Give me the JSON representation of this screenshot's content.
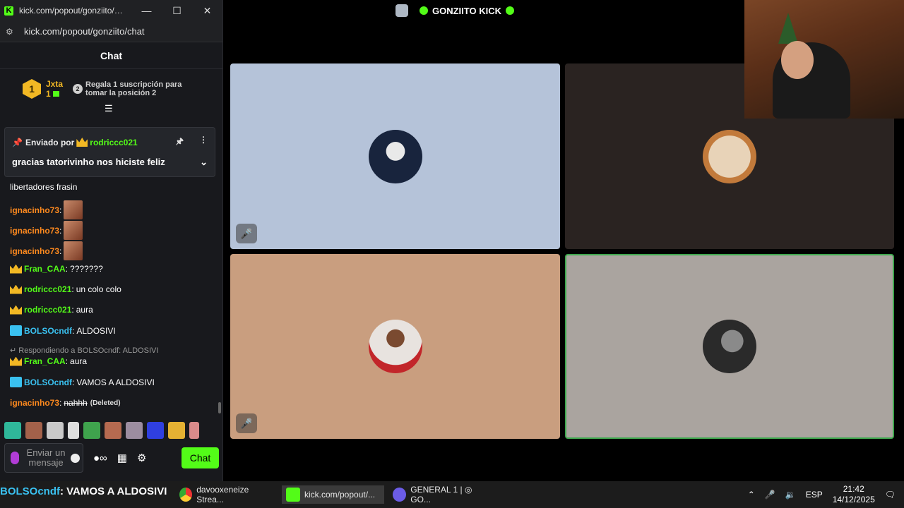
{
  "chat_window": {
    "title": "kick.com/popout/gonziito/chat",
    "url": "kick.com/popout/gonziito/chat",
    "minimize_icon": "minimize-icon",
    "maximize_icon": "maximize-icon",
    "close_icon": "close-icon",
    "header": "Chat"
  },
  "leaderboard": {
    "rank": "1",
    "name": "Jxta",
    "count": "1",
    "rank2": "2",
    "gift_text": "Regala 1 suscripción para tomar la posición 2"
  },
  "pinned": {
    "sent_by": "Enviado por",
    "user": "rodriccc021",
    "message": "gracias tatorivinho nos hiciste feliz"
  },
  "messages": [
    {
      "user": "",
      "text": "libertadores frasin",
      "color": "#ffffff"
    },
    {
      "user": "ignacinho73",
      "text": "",
      "color": "#ff8a1e",
      "emote": true
    },
    {
      "user": "ignacinho73",
      "text": "",
      "color": "#ff8a1e",
      "emote": true
    },
    {
      "user": "ignacinho73",
      "text": "",
      "color": "#ff8a1e",
      "emote": true
    },
    {
      "user": "Fran_CAA",
      "text": "???????",
      "color": "#53fc18",
      "badge": "crown"
    },
    {
      "user": "rodriccc021",
      "text": "un colo colo",
      "color": "#53fc18",
      "badge": "crown"
    },
    {
      "user": "rodriccc021",
      "text": "aura",
      "color": "#53fc18",
      "badge": "crown"
    },
    {
      "user": "BOLSOcndf",
      "text": "ALDOSIVI",
      "color": "#3ac1f0",
      "badge": "sub"
    },
    {
      "user": "Fran_CAA",
      "text": "aura",
      "color": "#53fc18",
      "badge": "crown"
    },
    {
      "user": "BOLSOcndf",
      "text": "VAMOS A ALDOSIVI",
      "color": "#3ac1f0",
      "badge": "sub"
    },
    {
      "user": "ignacinho73",
      "text": "nahhh",
      "color": "#ff8a1e",
      "deleted": "(Deleted)"
    }
  ],
  "reply": "Respondiendo a BOLSOcndf: ALDOSIVI",
  "input": {
    "placeholder": "Enviar un mensaje",
    "send_label": "Chat"
  },
  "stage": {
    "title": "GONZIITO KICK"
  },
  "tiles_colors": [
    "#b5c3d9",
    "#2a2321",
    "#c99e7f",
    "#aaa49f"
  ],
  "taskbar": {
    "overlay_user": "BOLSOcndf",
    "overlay_text": ": VAMOS A ALDOSIVI",
    "item1": "davooxeneize Strea...",
    "item2": "kick.com/popout/...",
    "item3": "GENERAL 1 | ◎ GO...",
    "lang": "ESP",
    "time": "21:42",
    "date": "14/12/2025"
  }
}
